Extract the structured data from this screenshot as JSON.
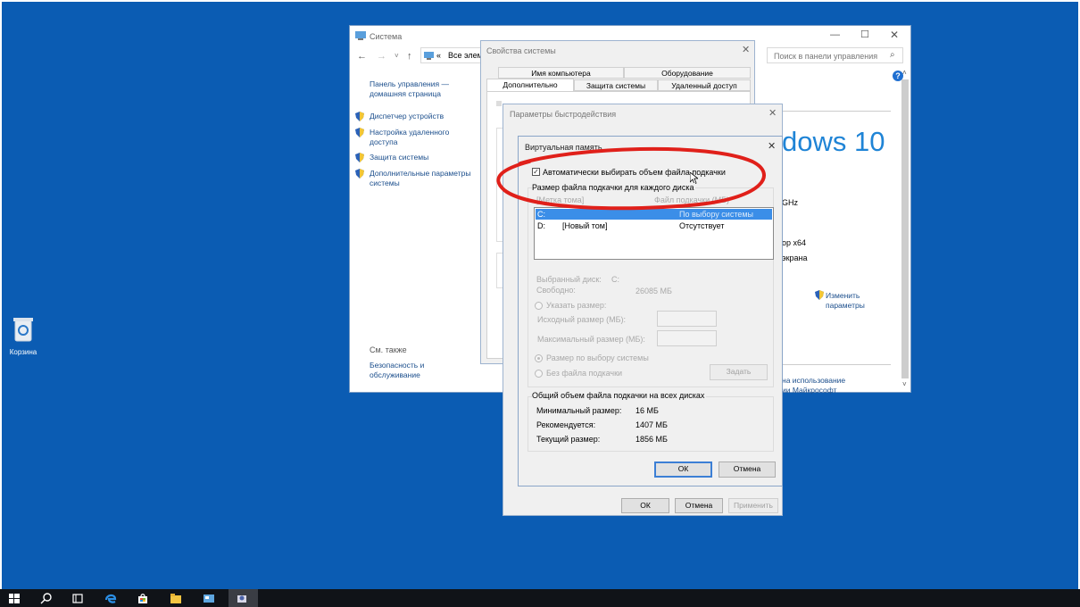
{
  "desktop": {
    "recycle_bin_label": "Корзина"
  },
  "system_window": {
    "title": "Система",
    "address_text": "Все элем",
    "search_placeholder": "Поиск в панели управления",
    "home_link": "Панель управления — домашняя страница",
    "links": [
      "Диспетчер устройств",
      "Настройка удаленного доступа",
      "Защита системы",
      "Дополнительные параметры системы"
    ],
    "see_also": "См. также",
    "security_link": "Безопасность и обслуживание",
    "windows_logo_text": "dows 10",
    "ghz_text": "GHz",
    "cpu_text": "ор x64",
    "screen_text": "экрана",
    "change_params": "Изменить параметры",
    "license_line1": "на использование",
    "license_line2": "ии Майкрософт"
  },
  "sysprops_window": {
    "title": "Свойства системы",
    "tabs_row1": [
      "Имя компьютера",
      "Оборудование"
    ],
    "tabs_row2": [
      "Дополнительно",
      "Защита системы",
      "Удаленный доступ"
    ]
  },
  "perf_window": {
    "title": "Параметры быстродействия",
    "ok": "ОК",
    "cancel": "Отмена",
    "apply": "Применить"
  },
  "vm_dialog": {
    "title": "Виртуальная память",
    "auto_checkbox": "Автоматически выбирать объем файла подкачки",
    "auto_checked": true,
    "per_disk_group": "Размер файла подкачки для каждого диска",
    "list_header_volume": "[Метка тома]",
    "list_header_size": "Файл подкачки (МБ)",
    "drives": [
      {
        "drive": "C:",
        "label": "",
        "size": "По выбору системы",
        "selected": true
      },
      {
        "drive": "D:",
        "label": "[Новый том]",
        "size": "Отсутствует",
        "selected": false
      }
    ],
    "selected_disk_label": "Выбранный диск:",
    "selected_disk_value": "C:",
    "free_label": "Свободно:",
    "free_value": "26085 МБ",
    "custom_size": "Указать размер:",
    "initial_size": "Исходный размер (МБ):",
    "max_size": "Максимальный размер (МБ):",
    "system_managed": "Размер по выбору системы",
    "no_paging": "Без файла подкачки",
    "set_button": "Задать",
    "total_group": "Общий объем файла подкачки на всех дисках",
    "min_label": "Минимальный размер:",
    "min_value": "16 МБ",
    "rec_label": "Рекомендуется:",
    "rec_value": "1407 МБ",
    "cur_label": "Текущий размер:",
    "cur_value": "1856 МБ",
    "ok": "ОК",
    "cancel": "Отмена"
  },
  "colors": {
    "desktop": "#0b5cb3",
    "annotation": "#e0201a",
    "selection": "#3b8ee8"
  }
}
